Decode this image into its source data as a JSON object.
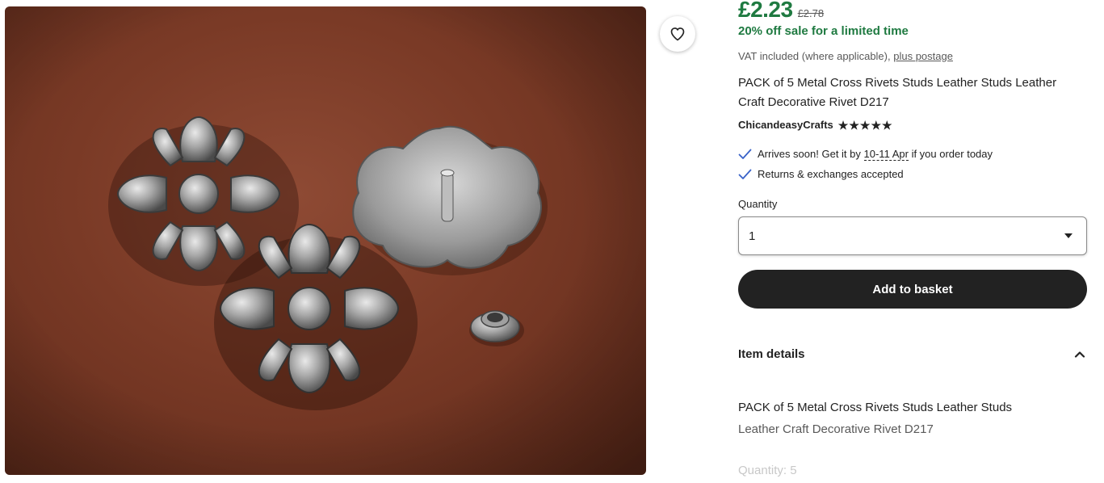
{
  "product": {
    "price": "£2.23",
    "original_price": "£2.78",
    "sale_text": "20% off sale for a limited time",
    "vat_text": "VAT included (where applicable),",
    "postage_link": "plus postage",
    "title": "PACK of 5 Metal Cross Rivets Studs Leather Studs Leather Craft Decorative Rivet D217"
  },
  "shop": {
    "name": "ChicandeasyCrafts",
    "rating_stars": 5
  },
  "perks": {
    "arrival_prefix": "Arrives soon! Get it by",
    "arrival_date": "10-11 Apr",
    "arrival_suffix": "if you order today",
    "returns": "Returns & exchanges accepted"
  },
  "quantity": {
    "label": "Quantity",
    "selected": "1"
  },
  "actions": {
    "add_to_basket": "Add to basket"
  },
  "item_details": {
    "heading": "Item details",
    "line1": "PACK of 5 Metal Cross Rivets Studs Leather Studs",
    "line2": "Leather Craft Decorative Rivet D217",
    "quantity_line": "Quantity: 5"
  },
  "icons": {
    "favorite": "heart-icon",
    "check": "check-icon",
    "dropdown": "caret-down-icon",
    "collapse": "chevron-up-icon"
  },
  "colors": {
    "price_green": "#1f7a41",
    "button_dark": "#222222",
    "photo_leather": "#7a3a26"
  }
}
